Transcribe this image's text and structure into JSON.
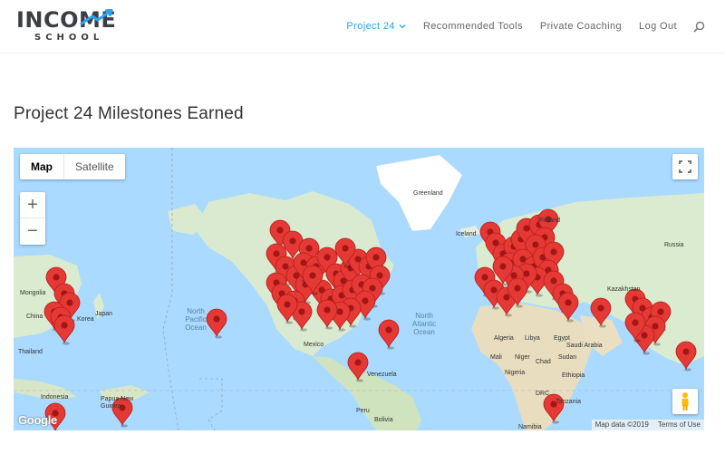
{
  "header": {
    "logo_top": "INCOME",
    "logo_bottom": "SCHOOL",
    "nav": [
      {
        "label": "Project 24",
        "active": true
      },
      {
        "label": "Recommended Tools"
      },
      {
        "label": "Private Coaching"
      },
      {
        "label": "Log Out"
      }
    ],
    "icons": {
      "search": "search-icon",
      "dropdown": "chevron-down-icon"
    }
  },
  "page": {
    "title": "Project 24 Milestones Earned"
  },
  "map": {
    "type_control": {
      "map": "Map",
      "satellite": "Satellite",
      "selected": "Map"
    },
    "zoom_in": "+",
    "zoom_out": "−",
    "google": "Google",
    "attribution": {
      "data": "Map data ©2019",
      "terms": "Terms of Use"
    },
    "labels": {
      "greenland": "Greenland",
      "iceland": "Iceland",
      "finland": "Finland",
      "russia": "Russia",
      "kazakhstan": "Kazakhstan",
      "mongolia": "Mongolia",
      "china": "China",
      "korea": "Korea",
      "japan": "Japan",
      "thailand": "Thailand",
      "indonesia": "Indonesia",
      "papua": "Papua New Guinea",
      "north_pacific": "North Pacific Ocean",
      "north_atlantic": "North Atlantic Ocean",
      "mexico": "Mexico",
      "venezuela": "Venezuela",
      "peru": "Peru",
      "bolivia": "Bolivia",
      "algeria": "Algeria",
      "libya": "Libya",
      "egypt": "Egypt",
      "mali": "Mali",
      "niger": "Niger",
      "chad": "Chad",
      "sudan": "Sudan",
      "nigeria": "Nigeria",
      "ethiopia": "Ethiopia",
      "saudi": "Saudi Arabia",
      "drc": "DRC",
      "tanzania": "Tanzania",
      "namibia": "Namibia"
    },
    "marker_color": "#e53935"
  }
}
